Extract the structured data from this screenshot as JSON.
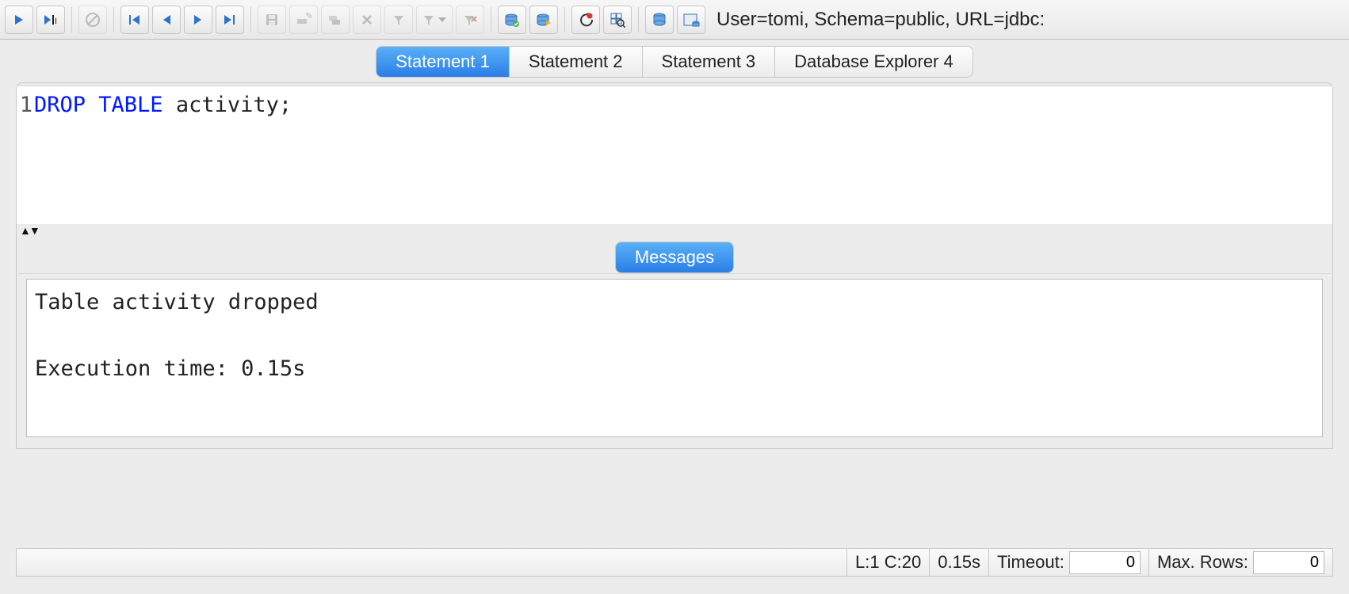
{
  "connection_string": "User=tomi, Schema=public, URL=jdbc:",
  "tabs": [
    {
      "label": "Statement 1",
      "active": true
    },
    {
      "label": "Statement 2",
      "active": false
    },
    {
      "label": "Statement 3",
      "active": false
    },
    {
      "label": "Database Explorer 4",
      "active": false
    }
  ],
  "editor": {
    "line_number": "1",
    "sql_keywords": "DROP TABLE",
    "sql_rest": " activity;"
  },
  "messages_tab_label": "Messages",
  "messages_text": "Table activity dropped\n\nExecution time: 0.15s",
  "status": {
    "cursor": "L:1 C:20",
    "exec_time": "0.15s",
    "timeout_label": "Timeout:",
    "timeout_value": "0",
    "maxrows_label": "Max. Rows:",
    "maxrows_value": "0"
  },
  "splitter_glyph": "▲▼"
}
